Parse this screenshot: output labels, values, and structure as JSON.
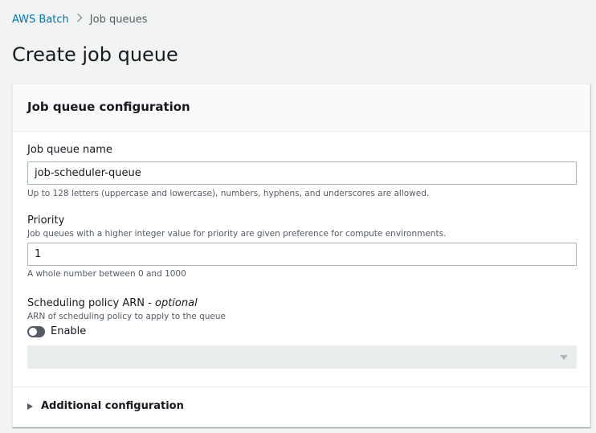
{
  "breadcrumb": {
    "items": [
      {
        "label": "AWS Batch"
      },
      {
        "label": "Job queues"
      }
    ],
    "separator": ">"
  },
  "page": {
    "title": "Create job queue"
  },
  "panel": {
    "title": "Job queue configuration",
    "fields": {
      "name": {
        "label": "Job queue name",
        "value": "job-scheduler-queue",
        "constraint": "Up to 128 letters (uppercase and lowercase), numbers, hyphens, and underscores are allowed."
      },
      "priority": {
        "label": "Priority",
        "description": "Job queues with a higher integer value for priority are given preference for compute environments.",
        "value": "1",
        "constraint": "A whole number between 0 and 1000"
      },
      "scheduling_policy": {
        "label": "Scheduling policy ARN",
        "optional_label": "optional",
        "description": "ARN of scheduling policy to apply to the queue",
        "toggle_label": "Enable",
        "toggle_on": false,
        "select_value": ""
      }
    },
    "additional": {
      "label": "Additional configuration"
    }
  },
  "colors": {
    "link": "#0073bb",
    "toggle_off": "#545b64",
    "disabled_bg": "#eaeded"
  }
}
